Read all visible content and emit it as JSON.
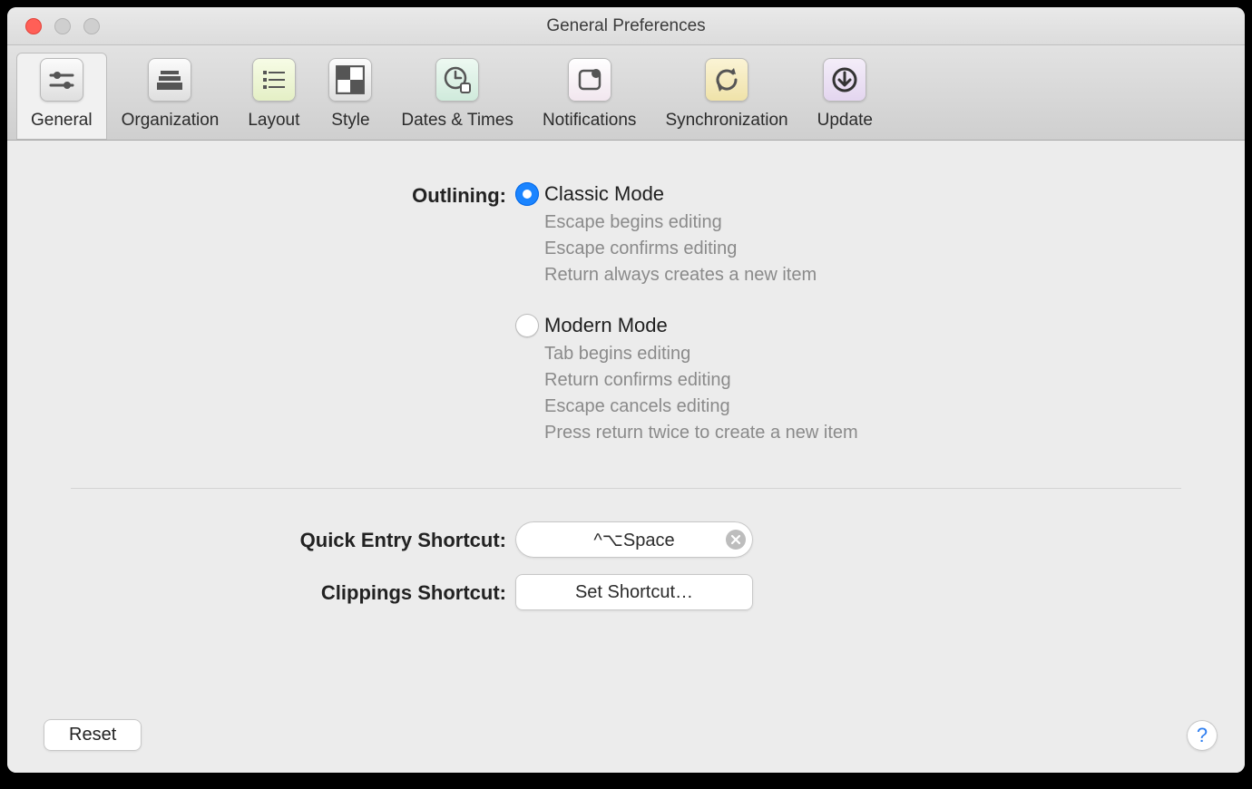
{
  "window": {
    "title": "General Preferences"
  },
  "toolbar": {
    "tabs": [
      {
        "label": "General"
      },
      {
        "label": "Organization"
      },
      {
        "label": "Layout"
      },
      {
        "label": "Style"
      },
      {
        "label": "Dates & Times"
      },
      {
        "label": "Notifications"
      },
      {
        "label": "Synchronization"
      },
      {
        "label": "Update"
      }
    ]
  },
  "section": {
    "outlining": {
      "label": "Outlining:",
      "classic": {
        "title": "Classic Mode",
        "desc1": "Escape begins editing",
        "desc2": "Escape confirms editing",
        "desc3": "Return always creates a new item"
      },
      "modern": {
        "title": "Modern Mode",
        "desc1": "Tab begins editing",
        "desc2": "Return confirms editing",
        "desc3": "Escape cancels editing",
        "desc4": "Press return twice to create a new item"
      }
    },
    "quick_entry": {
      "label": "Quick Entry Shortcut:",
      "value": "^⌥Space"
    },
    "clippings": {
      "label": "Clippings Shortcut:",
      "button": "Set Shortcut…"
    }
  },
  "footer": {
    "reset": "Reset",
    "help": "?"
  }
}
